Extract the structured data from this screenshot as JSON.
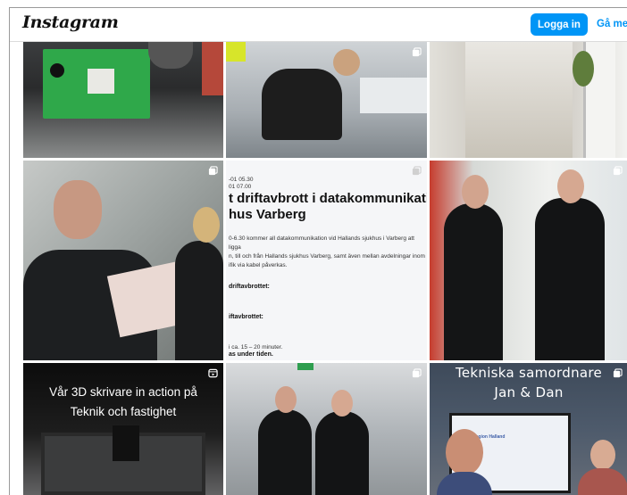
{
  "header": {
    "logo": "Instagram",
    "login_label": "Logga in",
    "signup_label": "Gå med"
  },
  "posts": {
    "post2": {
      "type": "carousel",
      "badge": "carousel-icon"
    },
    "post5": {
      "type": "carousel",
      "badge": "carousel-icon",
      "time_line_1": "-01 05.30",
      "time_line_2": "01 07.00",
      "headline_line_1": "t driftavbrott i datakommunikatione",
      "headline_line_2": "hus Varberg",
      "body_line_1": "0-6.30 kommer all datakommunikation vid Hallands sjukhus i Varberg att ligga",
      "body_line_2": "n, till och från Hallands sjukhus Varberg, samt även mellan avdelningar inom",
      "body_line_3": "ifik via kabel påverkas.",
      "section_1": "driftavbrottet:",
      "section_2": "iftavbrottet:",
      "duration": "i ca. 15 – 20 minuter.",
      "note": "as under tiden."
    },
    "post6": {
      "type": "carousel",
      "badge": "carousel-icon"
    },
    "post7": {
      "type": "reel",
      "badge": "reel-icon",
      "overlay_line_1": "Vår 3D skrivare in action på",
      "overlay_line_2": "Teknik och fastighet"
    },
    "post8": {
      "type": "carousel",
      "badge": "carousel-icon"
    },
    "post9": {
      "type": "carousel",
      "badge": "carousel-icon",
      "overlay_line_1": "Tekniska samordnare",
      "overlay_line_2": "Jan & Dan",
      "screen_text": "Region Halland"
    }
  },
  "colors": {
    "accent": "#0095f6",
    "border": "#dbdbdb"
  }
}
